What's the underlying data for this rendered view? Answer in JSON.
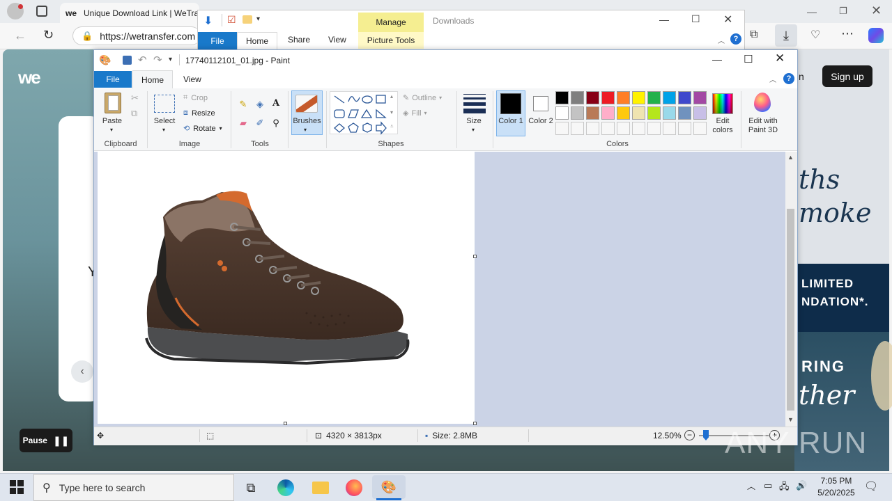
{
  "edge": {
    "tab_title": "Unique Download Link | WeTra",
    "url": "https://wetransfer.com"
  },
  "website": {
    "logo": "we",
    "signup": "Sign up",
    "pause": "Pause",
    "side_text_1": "ths",
    "side_text_2": "moke",
    "side_text_3": "LIMITED",
    "side_text_4": "NDATION*.",
    "side_text_5": "RING",
    "side_text_6": "ther",
    "partial_letter": "Y",
    "partial_n": "n"
  },
  "explorer": {
    "tab_file": "File",
    "tab_home": "Home",
    "tab_share": "Share",
    "tab_view": "View",
    "tab_manage": "Manage",
    "tab_picture_tools": "Picture Tools",
    "title": "Downloads"
  },
  "paint": {
    "title": "17740112101_01.jpg - Paint",
    "tab_file": "File",
    "tab_home": "Home",
    "tab_view": "View",
    "clipboard": {
      "paste": "Paste",
      "label": "Clipboard"
    },
    "image": {
      "select": "Select",
      "crop": "Crop",
      "resize": "Resize",
      "rotate": "Rotate",
      "label": "Image"
    },
    "tools": {
      "label": "Tools"
    },
    "brushes": "Brushes",
    "shapes": {
      "outline": "Outline",
      "fill": "Fill",
      "label": "Shapes"
    },
    "size": "Size",
    "color1": "Color 1",
    "color2": "Color 2",
    "colors_label": "Colors",
    "edit_colors": "Edit colors",
    "edit_paint3d": "Edit with Paint 3D",
    "palette_row1": [
      "#000000",
      "#7f7f7f",
      "#880015",
      "#ed1c24",
      "#ff7f27",
      "#fff200",
      "#22b14c",
      "#00a2e8",
      "#3f48cc",
      "#a349a4"
    ],
    "palette_row2": [
      "#ffffff",
      "#c3c3c3",
      "#b97a57",
      "#ffaec9",
      "#ffc90e",
      "#efe4b0",
      "#b5e61d",
      "#99d9ea",
      "#7092be",
      "#c8bfe7"
    ],
    "status": {
      "dimensions": "4320 × 3813px",
      "size": "Size: 2.8MB",
      "zoom": "12.50%"
    }
  },
  "taskbar": {
    "search_placeholder": "Type here to search",
    "time": "7:05 PM",
    "date": "5/20/2025"
  },
  "watermark": "ANY RUN"
}
